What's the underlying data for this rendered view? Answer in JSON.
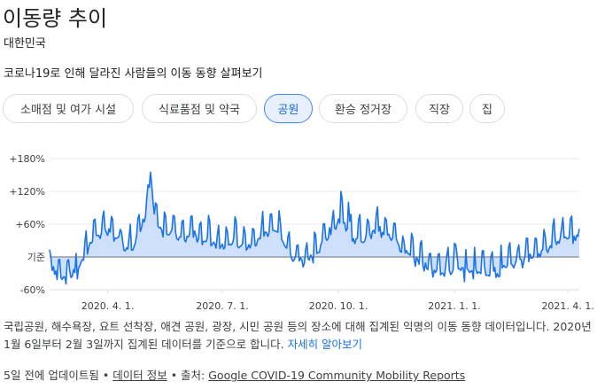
{
  "header": {
    "title": "이동량 추이",
    "region": "대한민국",
    "description": "코로나19로 인해 달라진 사람들의 이동 동향 살펴보기"
  },
  "tabs": [
    {
      "label": "소매점 및 여가 시설",
      "active": false
    },
    {
      "label": "식료품점 및 약국",
      "active": false
    },
    {
      "label": "공원",
      "active": true
    },
    {
      "label": "환승 정거장",
      "active": false
    },
    {
      "label": "직장",
      "active": false
    },
    {
      "label": "집",
      "active": false
    }
  ],
  "colors": {
    "line": "#1a73e8",
    "fill": "#c6dafc",
    "grid": "#e8eaed",
    "baseline": "#5f6368"
  },
  "chart_data": {
    "type": "area",
    "ylim": [
      -60,
      180
    ],
    "y_ticks": [
      {
        "value": 180,
        "label": "+180%"
      },
      {
        "value": 120,
        "label": "+120%"
      },
      {
        "value": 60,
        "label": "+60%"
      },
      {
        "value": 0,
        "label": "기준"
      },
      {
        "value": -60,
        "label": "-60%"
      }
    ],
    "x_start": "2020-02-15",
    "x_end": "2021-04-10",
    "x_ticks": [
      {
        "date": "2020-04-01",
        "label": "2020. 4. 1."
      },
      {
        "date": "2020-07-01",
        "label": "2020. 7. 1."
      },
      {
        "date": "2020-10-01",
        "label": "2020. 10. 1."
      },
      {
        "date": "2021-01-01",
        "label": "2021. 1. 1."
      },
      {
        "date": "2021-04-01",
        "label": "2021. 4. 1."
      }
    ],
    "anchors": [
      [
        "2020-02-15",
        -10
      ],
      [
        "2020-02-22",
        -25
      ],
      [
        "2020-02-29",
        -30
      ],
      [
        "2020-03-07",
        -15
      ],
      [
        "2020-03-14",
        15
      ],
      [
        "2020-03-21",
        45
      ],
      [
        "2020-03-28",
        55
      ],
      [
        "2020-04-04",
        50
      ],
      [
        "2020-04-11",
        40
      ],
      [
        "2020-04-18",
        20
      ],
      [
        "2020-04-25",
        45
      ],
      [
        "2020-05-02",
        90
      ],
      [
        "2020-05-05",
        155
      ],
      [
        "2020-05-09",
        70
      ],
      [
        "2020-05-16",
        50
      ],
      [
        "2020-05-23",
        55
      ],
      [
        "2020-05-30",
        40
      ],
      [
        "2020-06-06",
        55
      ],
      [
        "2020-06-13",
        45
      ],
      [
        "2020-06-20",
        40
      ],
      [
        "2020-06-27",
        25
      ],
      [
        "2020-07-04",
        30
      ],
      [
        "2020-07-11",
        40
      ],
      [
        "2020-07-18",
        25
      ],
      [
        "2020-07-25",
        35
      ],
      [
        "2020-08-01",
        45
      ],
      [
        "2020-08-08",
        60
      ],
      [
        "2020-08-15",
        55
      ],
      [
        "2020-08-22",
        15
      ],
      [
        "2020-08-29",
        5
      ],
      [
        "2020-09-05",
        0
      ],
      [
        "2020-09-12",
        10
      ],
      [
        "2020-09-19",
        35
      ],
      [
        "2020-09-26",
        60
      ],
      [
        "2020-10-03",
        85
      ],
      [
        "2020-10-10",
        50
      ],
      [
        "2020-10-17",
        40
      ],
      [
        "2020-10-24",
        45
      ],
      [
        "2020-10-31",
        60
      ],
      [
        "2020-11-07",
        55
      ],
      [
        "2020-11-14",
        45
      ],
      [
        "2020-11-21",
        20
      ],
      [
        "2020-11-28",
        10
      ],
      [
        "2020-12-05",
        0
      ],
      [
        "2020-12-12",
        -15
      ],
      [
        "2020-12-19",
        -20
      ],
      [
        "2020-12-26",
        -15
      ],
      [
        "2021-01-02",
        -5
      ],
      [
        "2021-01-09",
        -20
      ],
      [
        "2021-01-16",
        -10
      ],
      [
        "2021-01-23",
        -15
      ],
      [
        "2021-01-30",
        -20
      ],
      [
        "2021-02-06",
        -15
      ],
      [
        "2021-02-13",
        0
      ],
      [
        "2021-02-20",
        -5
      ],
      [
        "2021-02-27",
        5
      ],
      [
        "2021-03-06",
        10
      ],
      [
        "2021-03-13",
        20
      ],
      [
        "2021-03-20",
        35
      ],
      [
        "2021-03-27",
        40
      ],
      [
        "2021-04-03",
        45
      ],
      [
        "2021-04-10",
        40
      ]
    ],
    "spikes": [
      [
        "2020-05-05",
        155
      ],
      [
        "2020-04-19",
        60
      ],
      [
        "2020-05-30",
        65
      ],
      [
        "2020-08-08",
        78
      ],
      [
        "2020-09-26",
        65
      ],
      [
        "2020-10-03",
        120
      ],
      [
        "2020-10-09",
        100
      ],
      [
        "2020-10-31",
        78
      ],
      [
        "2021-03-28",
        72
      ],
      [
        "2021-04-04",
        75
      ],
      [
        "2021-01-01",
        25
      ],
      [
        "2020-03-08",
        -40
      ],
      [
        "2021-01-09",
        -45
      ],
      [
        "2021-01-16",
        -40
      ],
      [
        "2021-02-06",
        -35
      ]
    ]
  },
  "note": {
    "text": "국립공원, 해수욕장, 요트 선착장, 애견 공원, 광장, 시민 공원 등의 장소에 대해 집계된 익명의 이동 동향 데이터입니다. 2020년 1월 6일부터 2월 3일까지 집계된 데이터를 기준으로 합니다. ",
    "link": "자세히 알아보기"
  },
  "footer": {
    "updated": "5일 전에 업데이트됨 • ",
    "data_info": "데이터 정보",
    "source_prefix": " • 출처: ",
    "source": "Google COVID-19 Community Mobility Reports"
  }
}
